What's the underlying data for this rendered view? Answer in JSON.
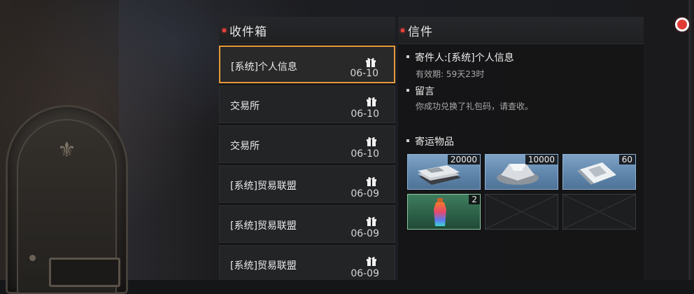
{
  "inbox": {
    "title": "收件箱",
    "mails": [
      {
        "from": "[系统]个人信息",
        "date": "06-10",
        "selected": true
      },
      {
        "from": "交易所",
        "date": "06-10",
        "selected": false
      },
      {
        "from": "交易所",
        "date": "06-10",
        "selected": false
      },
      {
        "from": "[系统]贸易联盟",
        "date": "06-09",
        "selected": false
      },
      {
        "from": "[系统]贸易联盟",
        "date": "06-09",
        "selected": false
      },
      {
        "from": "[系统]贸易联盟",
        "date": "06-09",
        "selected": false
      }
    ]
  },
  "detail": {
    "title": "信件",
    "sender": "寄件人:[系统]个人信息",
    "validity": "有效期: 59天23时",
    "message_heading": "留言",
    "message": "你成功兑换了礼包码，请查收。",
    "attachments_heading": "寄运物品",
    "attachments": [
      {
        "icon": "cash-bundle-icon",
        "qty": "20000",
        "rarity": "blue"
      },
      {
        "icon": "silver-ingot-icon",
        "qty": "10000",
        "rarity": "blue"
      },
      {
        "icon": "sealed-packet-icon",
        "qty": "60",
        "rarity": "blue"
      },
      {
        "icon": "potion-bottle-icon",
        "qty": "2",
        "rarity": "green"
      }
    ]
  },
  "colors": {
    "accent_red": "#e0413a",
    "selected_border": "#e59a3a",
    "rarity_blue": "#6f94b8",
    "rarity_green": "#2f6a4f"
  }
}
